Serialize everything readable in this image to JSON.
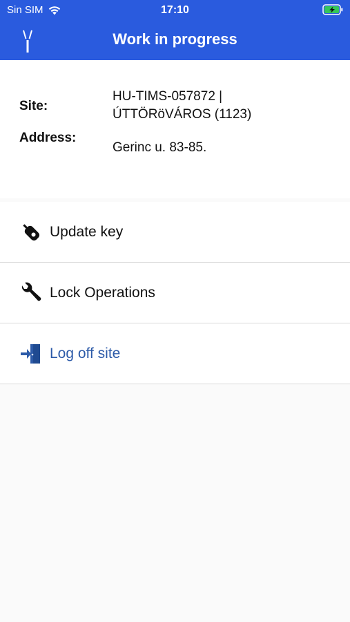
{
  "status_bar": {
    "carrier": "Sin SIM",
    "time": "17:10"
  },
  "header": {
    "title": "Work in progress",
    "color": "#2a5bde"
  },
  "site_info": {
    "site_label": "Site:",
    "site_value_line1": "HU-TIMS-057872 |",
    "site_value_line2": "ÚTTÖRöVÁROS (1123)",
    "address_label": "Address:",
    "address_value": "Gerinc u. 83-85."
  },
  "menu": {
    "items": [
      {
        "label": "Update key",
        "icon": "key-fob-icon"
      },
      {
        "label": "Lock Operations",
        "icon": "wrench-icon"
      },
      {
        "label": "Log off site",
        "icon": "exit-door-icon",
        "color": "#2c5aa8"
      }
    ]
  }
}
